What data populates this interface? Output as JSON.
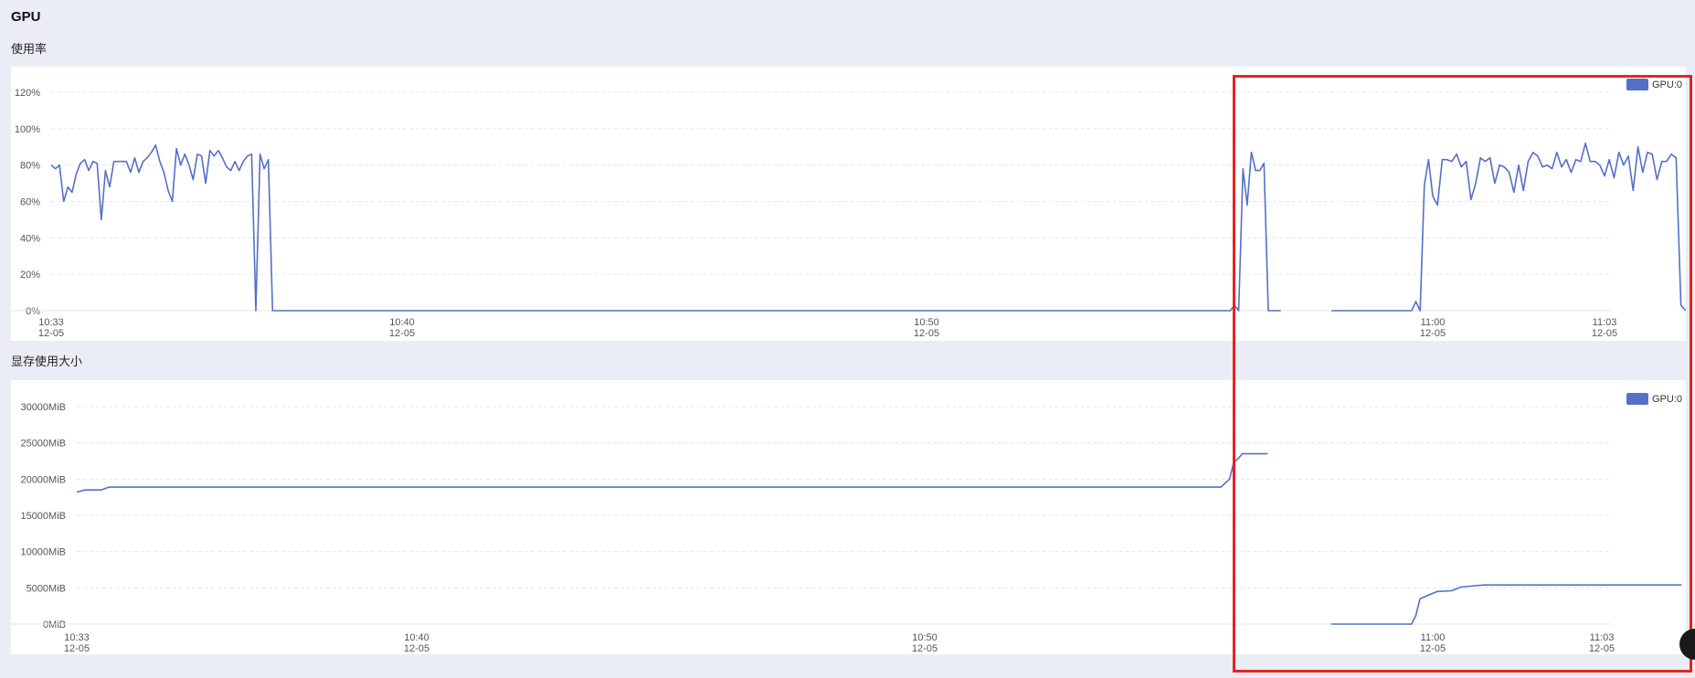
{
  "header": {
    "title": "GPU"
  },
  "colors": {
    "series": "#5470c6",
    "highlight": "#e8231f",
    "panel_bg": "#ffffff",
    "page_bg": "#eaedf5"
  },
  "chart_data": [
    {
      "type": "line",
      "caption": "使用率",
      "legend": {
        "entries": [
          "GPU:0"
        ],
        "placement": "top-right"
      },
      "grid": true,
      "ylim": [
        0,
        120
      ],
      "yticks": [
        {
          "value": 0,
          "label": "0%"
        },
        {
          "value": 20,
          "label": "20%"
        },
        {
          "value": 40,
          "label": "40%"
        },
        {
          "value": 60,
          "label": "60%"
        },
        {
          "value": 80,
          "label": "80%"
        },
        {
          "value": 100,
          "label": "100%"
        },
        {
          "value": 120,
          "label": "120%"
        }
      ],
      "xlim": [
        "10:33",
        "11:03"
      ],
      "xticks": [
        {
          "t": "10:33",
          "time": "10:33",
          "date": "12-05"
        },
        {
          "t": "10:40",
          "time": "10:40",
          "date": "12-05"
        },
        {
          "t": "10:50",
          "time": "10:50",
          "date": "12-05"
        },
        {
          "t": "11:00",
          "time": "11:00",
          "date": "12-05"
        },
        {
          "t": "11:03",
          "time": "11:03",
          "date": "12-05"
        }
      ],
      "series": [
        {
          "name": "GPU:0",
          "segments": [
            [
              [
                "10:33:00",
                80
              ],
              [
                "10:33:05",
                78
              ],
              [
                "10:33:10",
                80
              ],
              [
                "10:33:15",
                60
              ],
              [
                "10:33:20",
                68
              ],
              [
                "10:33:25",
                65
              ],
              [
                "10:33:30",
                75
              ],
              [
                "10:33:35",
                81
              ],
              [
                "10:33:40",
                83
              ],
              [
                "10:33:45",
                77
              ],
              [
                "10:33:50",
                82
              ],
              [
                "10:33:55",
                81
              ],
              [
                "10:34:00",
                50
              ],
              [
                "10:34:05",
                77
              ],
              [
                "10:34:10",
                68
              ],
              [
                "10:34:15",
                82
              ],
              [
                "10:34:20",
                82
              ],
              [
                "10:34:25",
                82
              ],
              [
                "10:34:30",
                82
              ],
              [
                "10:34:35",
                76
              ],
              [
                "10:34:40",
                84
              ],
              [
                "10:34:45",
                76
              ],
              [
                "10:34:50",
                82
              ],
              [
                "10:34:55",
                84
              ],
              [
                "10:35:00",
                87
              ],
              [
                "10:35:05",
                91
              ],
              [
                "10:35:10",
                82
              ],
              [
                "10:35:15",
                76
              ],
              [
                "10:35:20",
                66
              ],
              [
                "10:35:25",
                60
              ],
              [
                "10:35:30",
                89
              ],
              [
                "10:35:35",
                80
              ],
              [
                "10:35:40",
                86
              ],
              [
                "10:35:45",
                80
              ],
              [
                "10:35:50",
                72
              ],
              [
                "10:35:55",
                86
              ],
              [
                "10:36:00",
                85
              ],
              [
                "10:36:05",
                70
              ],
              [
                "10:36:10",
                88
              ],
              [
                "10:36:15",
                85
              ],
              [
                "10:36:20",
                88
              ],
              [
                "10:36:25",
                84
              ],
              [
                "10:36:30",
                79
              ],
              [
                "10:36:35",
                77
              ],
              [
                "10:36:40",
                82
              ],
              [
                "10:36:45",
                77
              ],
              [
                "10:36:50",
                82
              ],
              [
                "10:36:55",
                85
              ],
              [
                "10:37:00",
                86
              ],
              [
                "10:37:05",
                0
              ],
              [
                "10:37:10",
                86
              ],
              [
                "10:37:15",
                78
              ],
              [
                "10:37:20",
                83
              ],
              [
                "10:37:25",
                0
              ],
              [
                "10:38:00",
                0
              ],
              [
                "10:40:00",
                0
              ],
              [
                "10:45:00",
                0
              ],
              [
                "10:50:00",
                0
              ],
              [
                "10:55:00",
                0
              ],
              [
                "10:56:00",
                0
              ],
              [
                "10:56:05",
                3
              ],
              [
                "10:56:10",
                0
              ],
              [
                "10:56:15",
                78
              ],
              [
                "10:56:20",
                58
              ],
              [
                "10:56:25",
                87
              ],
              [
                "10:56:30",
                77
              ],
              [
                "10:56:35",
                77
              ],
              [
                "10:56:40",
                81
              ],
              [
                "10:56:45",
                0
              ],
              [
                "10:57:00",
                0
              ]
            ],
            [
              [
                "10:58:00",
                0
              ],
              [
                "10:59:00",
                0
              ],
              [
                "10:59:35",
                0
              ],
              [
                "10:59:40",
                5
              ],
              [
                "10:59:45",
                0
              ],
              [
                "10:59:50",
                69
              ],
              [
                "10:59:55",
                83
              ],
              [
                "11:00:00",
                63
              ],
              [
                "11:00:05",
                58
              ],
              [
                "11:00:10",
                83
              ],
              [
                "11:00:15",
                83
              ],
              [
                "11:00:20",
                82
              ],
              [
                "11:00:25",
                86
              ],
              [
                "11:00:30",
                79
              ],
              [
                "11:00:35",
                82
              ],
              [
                "11:00:40",
                61
              ],
              [
                "11:00:45",
                70
              ],
              [
                "11:00:50",
                84
              ],
              [
                "11:00:55",
                82
              ],
              [
                "11:01:00",
                84
              ],
              [
                "11:01:05",
                70
              ],
              [
                "11:01:10",
                80
              ],
              [
                "11:01:15",
                79
              ],
              [
                "11:01:20",
                76
              ],
              [
                "11:01:25",
                65
              ],
              [
                "11:01:30",
                80
              ],
              [
                "11:01:35",
                66
              ],
              [
                "11:01:40",
                82
              ],
              [
                "11:01:45",
                87
              ],
              [
                "11:01:50",
                85
              ],
              [
                "11:01:55",
                79
              ],
              [
                "11:02:00",
                80
              ],
              [
                "11:02:05",
                78
              ],
              [
                "11:02:10",
                87
              ],
              [
                "11:02:15",
                79
              ],
              [
                "11:02:20",
                83
              ],
              [
                "11:02:25",
                76
              ],
              [
                "11:02:30",
                83
              ],
              [
                "11:02:35",
                82
              ],
              [
                "11:02:40",
                92
              ],
              [
                "11:02:45",
                82
              ],
              [
                "11:02:50",
                82
              ],
              [
                "11:02:55",
                80
              ],
              [
                "11:03:00",
                74
              ],
              [
                "11:03:05",
                83
              ],
              [
                "11:03:10",
                73
              ],
              [
                "11:03:15",
                87
              ],
              [
                "11:03:20",
                80
              ],
              [
                "11:03:25",
                85
              ],
              [
                "11:03:30",
                66
              ],
              [
                "11:03:35",
                90
              ],
              [
                "11:03:40",
                76
              ],
              [
                "11:03:45",
                87
              ],
              [
                "11:03:50",
                86
              ],
              [
                "11:03:55",
                72
              ],
              [
                "11:04:00",
                82
              ],
              [
                "11:04:05",
                82
              ],
              [
                "11:04:10",
                86
              ],
              [
                "11:04:15",
                84
              ],
              [
                "11:04:20",
                3
              ],
              [
                "11:04:25",
                0
              ]
            ]
          ]
        }
      ]
    },
    {
      "type": "line",
      "caption": "显存使用大小",
      "legend": {
        "entries": [
          "GPU:0"
        ],
        "placement": "top-right"
      },
      "grid": true,
      "ylim": [
        0,
        30000
      ],
      "yticks": [
        {
          "value": 0,
          "label": "0MiB"
        },
        {
          "value": 5000,
          "label": "5000MiB"
        },
        {
          "value": 10000,
          "label": "10000MiB"
        },
        {
          "value": 15000,
          "label": "15000MiB"
        },
        {
          "value": 20000,
          "label": "20000MiB"
        },
        {
          "value": 25000,
          "label": "25000MiB"
        },
        {
          "value": 30000,
          "label": "30000MiB"
        }
      ],
      "xlim": [
        "10:33",
        "11:03"
      ],
      "xticks": [
        {
          "t": "10:33",
          "time": "10:33",
          "date": "12-05"
        },
        {
          "t": "10:40",
          "time": "10:40",
          "date": "12-05"
        },
        {
          "t": "10:50",
          "time": "10:50",
          "date": "12-05"
        },
        {
          "t": "11:00",
          "time": "11:00",
          "date": "12-05"
        },
        {
          "t": "11:03",
          "time": "11:03",
          "date": "12-05"
        }
      ],
      "series": [
        {
          "name": "GPU:0",
          "segments": [
            [
              [
                "10:33:00",
                18200
              ],
              [
                "10:33:10",
                18500
              ],
              [
                "10:33:30",
                18500
              ],
              [
                "10:33:40",
                18900
              ],
              [
                "10:40:00",
                18900
              ],
              [
                "10:50:00",
                18900
              ],
              [
                "10:55:00",
                18900
              ],
              [
                "10:55:50",
                18900
              ],
              [
                "10:56:00",
                20000
              ],
              [
                "10:56:05",
                22300
              ],
              [
                "10:56:10",
                22800
              ],
              [
                "10:56:15",
                23500
              ],
              [
                "10:56:30",
                23500
              ],
              [
                "10:56:45",
                23500
              ]
            ],
            [
              [
                "10:58:00",
                0
              ],
              [
                "10:59:00",
                0
              ],
              [
                "10:59:35",
                0
              ],
              [
                "10:59:40",
                1200
              ],
              [
                "10:59:45",
                3500
              ],
              [
                "10:59:55",
                4000
              ],
              [
                "11:00:05",
                4500
              ],
              [
                "11:00:20",
                4600
              ],
              [
                "11:00:30",
                5100
              ],
              [
                "11:00:45",
                5300
              ],
              [
                "11:00:55",
                5400
              ],
              [
                "11:02:00",
                5400
              ],
              [
                "11:03:00",
                5400
              ],
              [
                "11:04:25",
                5400
              ]
            ]
          ]
        }
      ]
    }
  ]
}
